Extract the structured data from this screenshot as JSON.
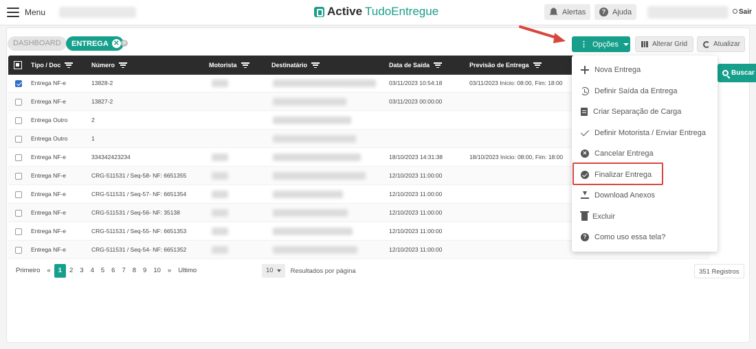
{
  "header": {
    "menu_label": "Menu",
    "brand_bold": "Active",
    "brand_light": "TudoEntregue",
    "alerts_label": "Alertas",
    "help_label": "Ajuda",
    "logout_label": "Sair"
  },
  "tabs": {
    "dashboard": "DASHBOARD",
    "entrega": "ENTREGA",
    "close_glyph": "✕"
  },
  "toolbar": {
    "options_label": "Opções",
    "alter_grid_label": "Alterar Grid",
    "refresh_label": "Atualizar",
    "search_label": "Buscar"
  },
  "table": {
    "columns": [
      "Tipo / Doc",
      "Número",
      "Motorista",
      "Destinatário",
      "Data de Saída",
      "Previsão de Entrega"
    ],
    "rows": [
      {
        "checked": true,
        "tipo": "Entrega NF-e",
        "numero": "13828-2",
        "data_saida": "03/11/2023 10:54:18",
        "previsao": "03/11/2023 Início: 08:00, Fim: 18:00"
      },
      {
        "checked": false,
        "tipo": "Entrega NF-e",
        "numero": "13827-2",
        "data_saida": "03/11/2023 00:00:00",
        "previsao": ""
      },
      {
        "checked": false,
        "tipo": "Entrega Outro",
        "numero": "2",
        "data_saida": "",
        "previsao": ""
      },
      {
        "checked": false,
        "tipo": "Entrega Outro",
        "numero": "1",
        "data_saida": "",
        "previsao": ""
      },
      {
        "checked": false,
        "tipo": "Entrega NF-e",
        "numero": "334342423234",
        "data_saida": "18/10/2023 14:31:38",
        "previsao": "18/10/2023 Início: 08:00, Fim: 18:00"
      },
      {
        "checked": false,
        "tipo": "Entrega NF-e",
        "numero": "CRG-511531 / Seq-58- NF: 6651355",
        "data_saida": "12/10/2023 11:00:00",
        "previsao": ""
      },
      {
        "checked": false,
        "tipo": "Entrega NF-e",
        "numero": "CRG-511531 / Seq-57- NF: 6651354",
        "data_saida": "12/10/2023 11:00:00",
        "previsao": ""
      },
      {
        "checked": false,
        "tipo": "Entrega NF-e",
        "numero": "CRG-511531 / Seq-56- NF: 35138",
        "data_saida": "12/10/2023 11:00:00",
        "previsao": ""
      },
      {
        "checked": false,
        "tipo": "Entrega NF-e",
        "numero": "CRG-511531 / Seq-55- NF: 6651353",
        "data_saida": "12/10/2023 11:00:00",
        "previsao": ""
      },
      {
        "checked": false,
        "tipo": "Entrega NF-e",
        "numero": "CRG-511531 / Seq-54- NF: 6651352",
        "data_saida": "12/10/2023 11:00:00",
        "previsao": ""
      }
    ]
  },
  "pagination": {
    "first": "Primeiro",
    "prev": "«",
    "pages": [
      "1",
      "2",
      "3",
      "4",
      "5",
      "6",
      "7",
      "8",
      "9",
      "10"
    ],
    "active_page": "1",
    "next": "»",
    "last": "Ultimo",
    "per_page_value": "10",
    "per_page_label": "Resultados por página",
    "total_label": "351 Registros"
  },
  "options_menu": {
    "items": [
      {
        "label": "Nova Entrega",
        "icon": "plus-icon"
      },
      {
        "label": "Definir Saída da Entrega",
        "icon": "history-icon"
      },
      {
        "label": "Criar Separação de Carga",
        "icon": "clipboard-icon"
      },
      {
        "label": "Definir Motorista / Enviar Entrega",
        "icon": "check-icon"
      },
      {
        "label": "Cancelar Entrega",
        "icon": "x-circle-icon"
      },
      {
        "label": "Finalizar Entrega",
        "icon": "check-circle-icon"
      },
      {
        "label": "Download Anexos",
        "icon": "download-icon"
      },
      {
        "label": "Excluir",
        "icon": "trash-icon"
      },
      {
        "label": "Como uso essa tela?",
        "icon": "question-circle-icon"
      }
    ],
    "highlighted": "Finalizar Entrega"
  },
  "colors": {
    "brand": "#16a08b",
    "table_header": "#2c2c2c",
    "annotation": "#d8463c",
    "checkbox_checked": "#2d6ec6"
  }
}
